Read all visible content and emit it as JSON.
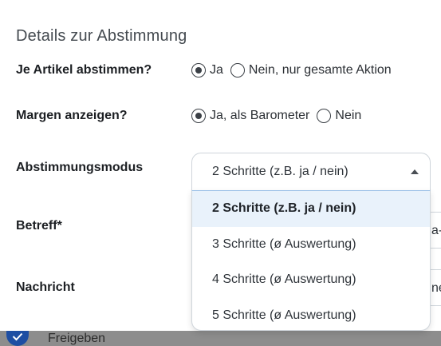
{
  "section": {
    "title": "Details zur Abstimmung"
  },
  "rows": {
    "per_item": {
      "label": "Je Artikel abstimmen?",
      "options": [
        "Ja",
        "Nein, nur gesamte Aktion"
      ],
      "selected": "Ja"
    },
    "margins": {
      "label": "Margen anzeigen?",
      "options": [
        "Ja, als Barometer",
        "Nein"
      ],
      "selected": "Ja, als Barometer"
    },
    "mode": {
      "label": "Abstimmungsmodus"
    },
    "subject": {
      "label": "Betreff*",
      "partial_value": "a-"
    },
    "message": {
      "label": "Nachricht",
      "partial_value": "ne"
    }
  },
  "select": {
    "value": "2 Schritte (z.B. ja / nein)",
    "options": [
      "2 Schritte (z.B. ja / nein)",
      "3 Schritte (ø Auswertung)",
      "4 Schritte (ø Auswertung)",
      "5 Schritte (ø Auswertung)"
    ],
    "expanded": true
  },
  "footer": {
    "label": "Freigeben"
  },
  "colors": {
    "accent": "#1d4ea3",
    "option_highlight": "#e9f2fb",
    "border": "#cfd5db"
  }
}
